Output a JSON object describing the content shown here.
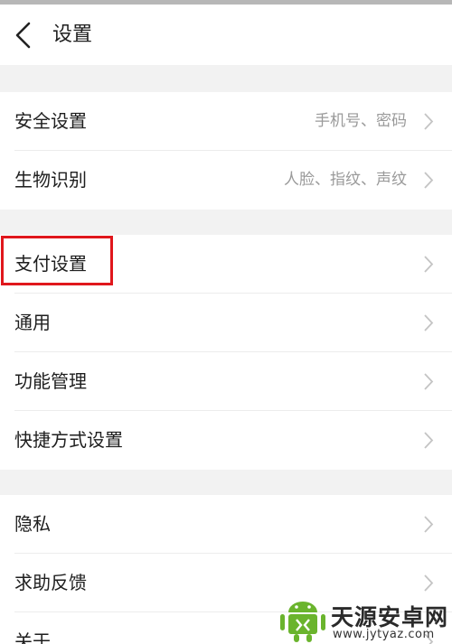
{
  "header": {
    "title": "设置",
    "back_icon": "chevron-left-icon"
  },
  "groups": [
    {
      "items": [
        {
          "label": "安全设置",
          "value": "手机号、密码"
        },
        {
          "label": "生物识别",
          "value": "人脸、指纹、声纹"
        }
      ]
    },
    {
      "items": [
        {
          "label": "支付设置",
          "value": ""
        },
        {
          "label": "通用",
          "value": ""
        },
        {
          "label": "功能管理",
          "value": ""
        },
        {
          "label": "快捷方式设置",
          "value": ""
        }
      ]
    },
    {
      "items": [
        {
          "label": "隐私",
          "value": ""
        },
        {
          "label": "求助反馈",
          "value": ""
        },
        {
          "label": "关于",
          "value": ""
        }
      ]
    }
  ],
  "annotation": {
    "highlighted_item": "支付设置",
    "color": "#e0171c"
  },
  "watermark": {
    "name": "天源安卓网",
    "url": "www.jytyaz.com",
    "logo_icon": "android-robot-icon"
  },
  "colors": {
    "background": "#f2f2f2",
    "card": "#ffffff",
    "secondary_text": "#9a9a9a"
  }
}
